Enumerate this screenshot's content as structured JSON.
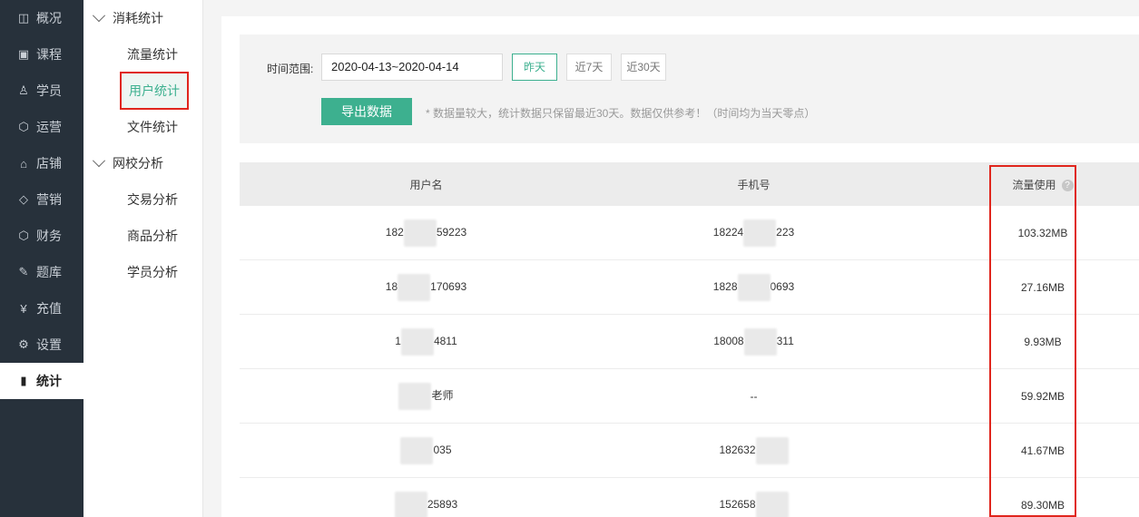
{
  "sidebar": {
    "items": [
      {
        "label": "概况",
        "icon": "chart-screen-icon",
        "glyph": "◫"
      },
      {
        "label": "课程",
        "icon": "book-icon",
        "glyph": "▣"
      },
      {
        "label": "学员",
        "icon": "user-icon",
        "glyph": "♙"
      },
      {
        "label": "运营",
        "icon": "cube-icon",
        "glyph": "⬡"
      },
      {
        "label": "店铺",
        "icon": "store-icon",
        "glyph": "⌂"
      },
      {
        "label": "营销",
        "icon": "tag-icon",
        "glyph": "◇"
      },
      {
        "label": "财务",
        "icon": "cube-icon",
        "glyph": "⬡"
      },
      {
        "label": "题库",
        "icon": "pen-icon",
        "glyph": "✎"
      },
      {
        "label": "充值",
        "icon": "yen-icon",
        "glyph": "¥"
      },
      {
        "label": "设置",
        "icon": "gear-icon",
        "glyph": "⚙"
      },
      {
        "label": "统计",
        "icon": "bar-chart-icon",
        "glyph": "▮"
      }
    ],
    "active_index": 10
  },
  "subnav": {
    "groups": [
      {
        "label": "消耗统计",
        "items": [
          "流量统计",
          "用户统计",
          "文件统计"
        ]
      },
      {
        "label": "网校分析",
        "items": [
          "交易分析",
          "商品分析",
          "学员分析"
        ]
      }
    ],
    "active_item": "用户统计"
  },
  "filter": {
    "label": "时间范围:",
    "date_range": "2020-04-13~2020-04-14",
    "quick": [
      "昨天",
      "近7天",
      "近30天"
    ],
    "export_label": "导出数据",
    "hint": "* 数据量较大，统计数据只保留最近30天。数据仅供参考！（时间均为当天零点）"
  },
  "table": {
    "headers": [
      "用户名",
      "手机号",
      "流量使用"
    ],
    "rows": [
      {
        "user": [
          "182",
          "59223"
        ],
        "phone": [
          "18224",
          "223"
        ],
        "flow": "103.32MB"
      },
      {
        "user": [
          "18",
          "170693"
        ],
        "phone": [
          "1828",
          "0693"
        ],
        "flow": "27.16MB"
      },
      {
        "user": [
          "1",
          "4811"
        ],
        "phone": [
          "18008",
          "311"
        ],
        "flow": "9.93MB"
      },
      {
        "user": [
          "",
          "老师"
        ],
        "phone": [
          "--",
          ""
        ],
        "flow": "59.92MB"
      },
      {
        "user": [
          "",
          "035"
        ],
        "phone": [
          "182632",
          ""
        ],
        "flow": "41.67MB"
      },
      {
        "user": [
          "",
          "25893"
        ],
        "phone": [
          "152658",
          ""
        ],
        "flow": "89.30MB"
      }
    ]
  },
  "colors": {
    "accent": "#3db08f",
    "sidebar_bg": "#27313b",
    "highlight": "#e0261d"
  }
}
